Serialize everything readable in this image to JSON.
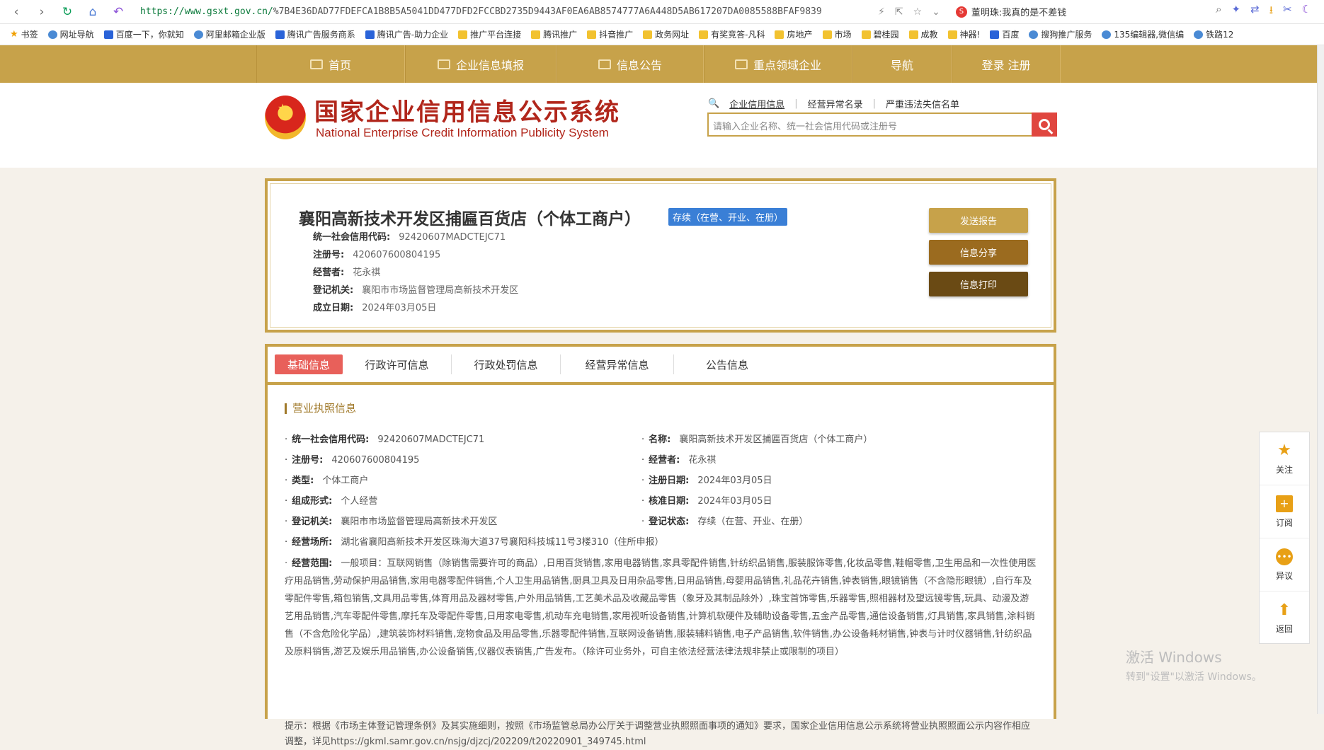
{
  "browser": {
    "url_host": "https://www.gsxt.gov.cn/",
    "url_path": "%7B4E36DAD77FDEFCA1B8B5A5041DD477DFD2FCCBD2735D9443AF0EA6AB8574777A6A448D5AB617207DA0085588BFAF9839",
    "news_text": "董明珠:我真的是不差钱",
    "bookmarks": [
      "书签",
      "网址导航",
      "百度一下，你就知",
      "阿里邮箱企业版",
      "腾讯广告服务商系",
      "腾讯广告-助力企业",
      "推广平台连接",
      "腾讯推广",
      "抖音推广",
      "政务网址",
      "有奖竞答-凡科",
      "房地产",
      "市场",
      "碧桂园",
      "成教",
      "神器!",
      "百度",
      "搜狗推广服务",
      "135编辑器,微信编",
      "铁路12"
    ]
  },
  "site_nav": [
    "首页",
    "企业信息填报",
    "信息公告",
    "重点领域企业",
    "导航",
    "登录  注册"
  ],
  "header": {
    "title_cn": "国家企业信用信息公示系统",
    "title_en": "National Enterprise Credit Information Publicity System",
    "search_links": [
      "企业信用信息",
      "经营异常名录",
      "严重违法失信名单"
    ],
    "search_placeholder": "请输入企业名称、统一社会信用代码或注册号"
  },
  "company": {
    "name": "襄阳高新技术开发区捕匾百货店（个体工商户）",
    "status": "存续（在营、开业、在册）",
    "fields": [
      {
        "label": "统一社会信用代码:",
        "value": "92420607MADCTEJC71"
      },
      {
        "label": "注册号:",
        "value": "420607600804195"
      },
      {
        "label": "经营者:",
        "value": "花永祺"
      },
      {
        "label": "登记机关:",
        "value": "襄阳市市场监督管理局高新技术开发区"
      },
      {
        "label": "成立日期:",
        "value": "2024年03月05日"
      }
    ],
    "buttons": [
      "发送报告",
      "信息分享",
      "信息打印"
    ]
  },
  "tabs": [
    "基础信息",
    "行政许可信息",
    "行政处罚信息",
    "经营异常信息",
    "公告信息"
  ],
  "license": {
    "section_title": "营业执照信息",
    "left": [
      {
        "label": "统一社会信用代码:",
        "value": "92420607MADCTEJC71"
      },
      {
        "label": "注册号:",
        "value": "420607600804195"
      },
      {
        "label": "类型:",
        "value": "个体工商户"
      },
      {
        "label": "组成形式:",
        "value": "个人经营"
      },
      {
        "label": "登记机关:",
        "value": "襄阳市市场监督管理局高新技术开发区"
      },
      {
        "label": "经营场所:",
        "value": "湖北省襄阳高新技术开发区珠海大道37号襄阳科技城11号3楼310（住所申报）"
      }
    ],
    "right": [
      {
        "label": "名称:",
        "value": "襄阳高新技术开发区捕匾百货店（个体工商户）"
      },
      {
        "label": "经营者:",
        "value": "花永祺"
      },
      {
        "label": "注册日期:",
        "value": "2024年03月05日"
      },
      {
        "label": "核准日期:",
        "value": "2024年03月05日"
      },
      {
        "label": "登记状态:",
        "value": "存续（在营、开业、在册）"
      }
    ],
    "scope_label": "经营范围:",
    "scope_value": "一般项目：互联网销售（除销售需要许可的商品）,日用百货销售,家用电器销售,家具零配件销售,针纺织品销售,服装服饰零售,化妆品零售,鞋帽零售,卫生用品和一次性使用医疗用品销售,劳动保护用品销售,家用电器零配件销售,个人卫生用品销售,厨具卫具及日用杂品零售,日用品销售,母婴用品销售,礼品花卉销售,钟表销售,眼镜销售（不含隐形眼镜）,自行车及零配件零售,箱包销售,文具用品零售,体育用品及器材零售,户外用品销售,工艺美术品及收藏品零售（象牙及其制品除外）,珠宝首饰零售,乐器零售,照相器材及望远镜零售,玩具、动漫及游艺用品销售,汽车零配件零售,摩托车及零配件零售,日用家电零售,机动车充电销售,家用视听设备销售,计算机软硬件及辅助设备零售,五金产品零售,通信设备销售,灯具销售,家具销售,涂料销售（不含危险化学品）,建筑装饰材料销售,宠物食品及用品零售,乐器零配件销售,互联网设备销售,服装辅料销售,电子产品销售,软件销售,办公设备耗材销售,钟表与计时仪器销售,针纺织品及原料销售,游艺及娱乐用品销售,办公设备销售,仪器仪表销售,广告发布。（除许可业务外，可自主依法经营法律法规非禁止或限制的项目）",
    "tip": "提示：根据《市场主体登记管理条例》及其实施细则，按照《市场监管总局办公厅关于调整营业执照照面事项的通知》要求，国家企业信用信息公示系统将营业执照照面公示内容作相应调整，详见https://gkml.samr.gov.cn/nsjg/djzcj/202209/t20220901_349745.html"
  },
  "sidebar": [
    "关注",
    "订阅",
    "异议",
    "返回"
  ],
  "watermark": {
    "line1": "激活 Windows",
    "line2": "转到\"设置\"以激活 Windows。"
  },
  "colors": {
    "gold": "#c7a24a",
    "red": "#b1261b",
    "tab_active": "#e8605a",
    "status_blue": "#3a7fd6"
  }
}
